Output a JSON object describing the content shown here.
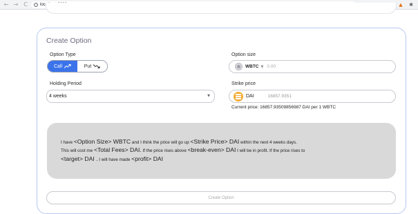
{
  "browser": {
    "url": "localhost:3000",
    "back": "←",
    "forward": "→",
    "reload": "C",
    "info": "i",
    "translate": "⊕",
    "star": "☆",
    "fox": "🦊",
    "puzzle": "✱"
  },
  "form": {
    "title": "Create Option",
    "option_type": {
      "label": "Option Type",
      "call_label": "Call",
      "put_label": "Put",
      "selected": "Call"
    },
    "option_size": {
      "label": "Option size",
      "currency": "WBTC",
      "placeholder": "0.00"
    },
    "holding_period": {
      "label": "Holding Period",
      "value": "4 weeks"
    },
    "strike_price": {
      "label": "Strike price",
      "currency": "DAI",
      "value": "16857.9351"
    },
    "current_price": "Current price: 16857.93509856987 DAI per 1 WBTC",
    "summary": {
      "line1_pre": "I have ",
      "option_size": "<Option Size>",
      "line1_mid1": " WBTC",
      "line1_mid2": " and I think the price will go up ",
      "strike_price": "<Strike Price>",
      "line1_mid3": " DAI",
      "line1_post": " within the next 4 weeks days.",
      "line2_pre": "This will cost me ",
      "total_fees": "<Total Fees>",
      "line2_mid1": " DAI.",
      "line2_mid2": " If the price rises above ",
      "break_even": "<break-even>",
      "line2_mid3": " DAI",
      "line2_post": " I will be in profit. If the price rises to",
      "target": "<target>",
      "line3_mid1": " DAI .",
      "line3_mid2": " I will have made ",
      "profit": "<profit>",
      "line3_mid3": " DAI"
    },
    "submit_label": "Create Option"
  },
  "colors": {
    "accent": "#3b73ea",
    "card_border": "#b9c7ef",
    "summary_bg": "#d9d9d9",
    "dai": "#f5ac37"
  }
}
